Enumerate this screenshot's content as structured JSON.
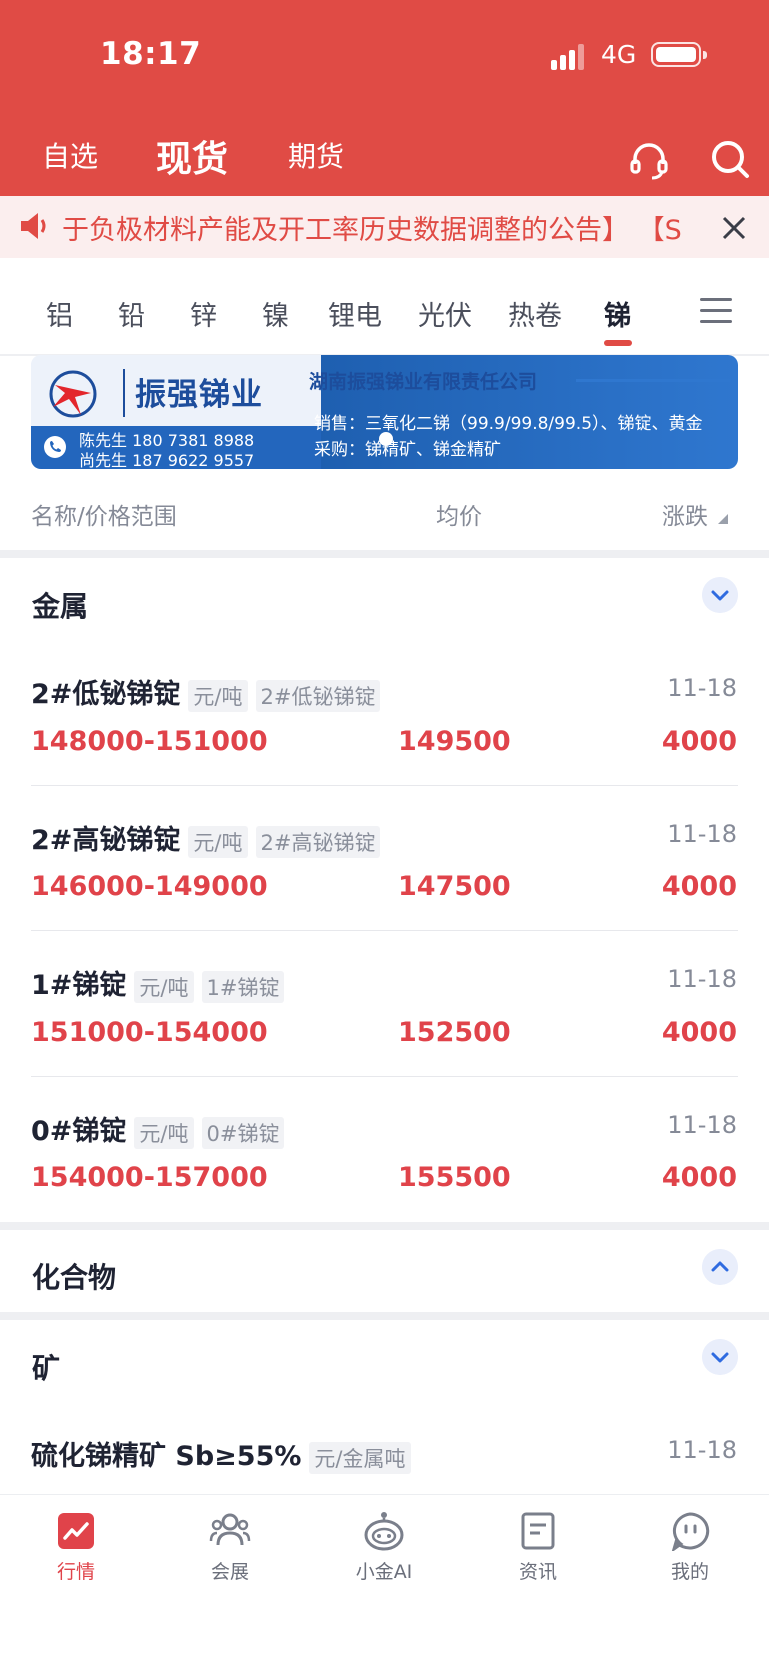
{
  "status_bar": {
    "time": "18:17",
    "network": "4G"
  },
  "header": {
    "tabs": [
      {
        "label": "自选"
      },
      {
        "label": "现货"
      },
      {
        "label": "期货"
      }
    ],
    "active_tab": "现货"
  },
  "notice": {
    "text": "于负极材料产能及开工率历史数据调整的公告】 【S"
  },
  "categories": {
    "items": [
      "铝",
      "铅",
      "锌",
      "镍",
      "锂电",
      "光伏",
      "热卷",
      "锑"
    ],
    "active": "锑"
  },
  "banner": {
    "brand": "振强锑业",
    "company": "湖南振强锑业有限责任公司",
    "contact_1": "陈先生 180 7381 8988",
    "contact_2": "尚先生 187 9622 9557",
    "sales": "销售：三氧化二锑（99.9/99.8/99.5）、锑锭、黄金",
    "purchase": "采购：锑精矿、锑金精矿"
  },
  "columns": {
    "name": "名称/价格范围",
    "avg": "均价",
    "change": "涨跌"
  },
  "sections": {
    "metal": {
      "title": "金属",
      "items": [
        {
          "name": "2#低铋锑锭",
          "unit": "元/吨",
          "tag": "2#低铋锑锭",
          "date": "11-18",
          "range": "148000-151000",
          "avg": "149500",
          "change": "4000"
        },
        {
          "name": "2#高铋锑锭",
          "unit": "元/吨",
          "tag": "2#高铋锑锭",
          "date": "11-18",
          "range": "146000-149000",
          "avg": "147500",
          "change": "4000"
        },
        {
          "name": "1#锑锭",
          "unit": "元/吨",
          "tag": "1#锑锭",
          "date": "11-18",
          "range": "151000-154000",
          "avg": "152500",
          "change": "4000"
        },
        {
          "name": "0#锑锭",
          "unit": "元/吨",
          "tag": "0#锑锭",
          "date": "11-18",
          "range": "154000-157000",
          "avg": "155500",
          "change": "4000"
        }
      ]
    },
    "compound": {
      "title": "化合物"
    },
    "ore": {
      "title": "矿",
      "items": [
        {
          "name": "硫化锑精矿 Sb≥55%",
          "unit": "元/金属吨",
          "date": "11-18"
        }
      ]
    }
  },
  "bottom_nav": {
    "items": [
      {
        "label": "行情"
      },
      {
        "label": "会展"
      },
      {
        "label": "小金AI"
      },
      {
        "label": "资讯"
      },
      {
        "label": "我的"
      }
    ]
  },
  "colors": {
    "brand_red": "#e04b45",
    "price_red": "#e0434a",
    "link_blue": "#2f6be0"
  }
}
